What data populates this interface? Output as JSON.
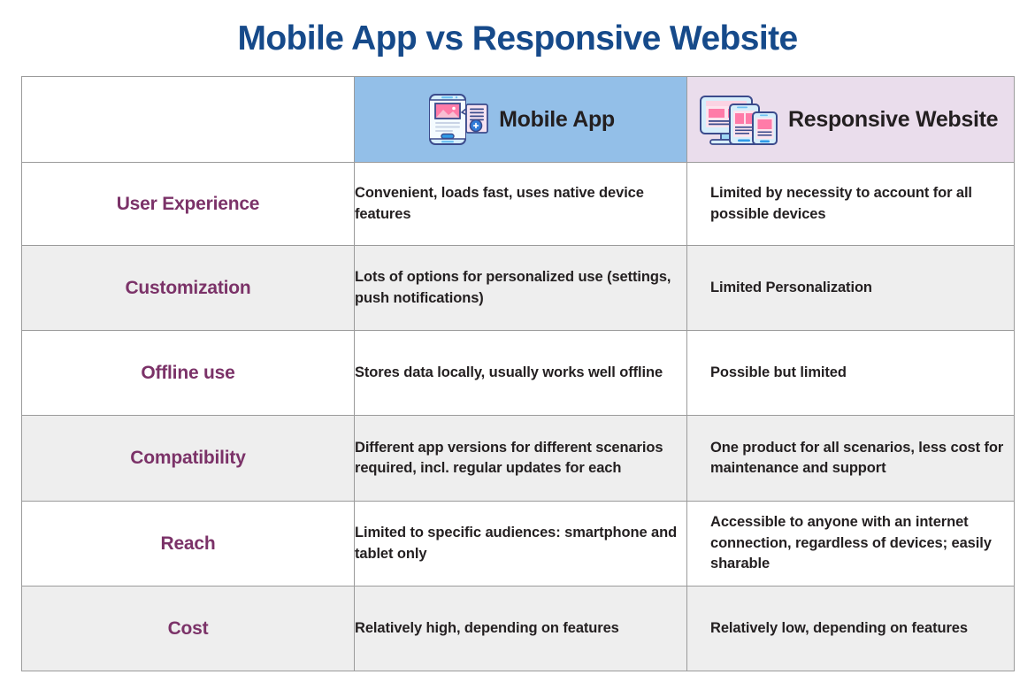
{
  "title": "Mobile App vs Responsive Website",
  "colors": {
    "title_blue": "#164A8A",
    "label_purple": "#7B3268",
    "header_app_bg": "#93BFE8",
    "header_web_bg": "#EADDEC",
    "row_shade_bg": "#EEEEEE",
    "border": "#9b9b9b",
    "body_text": "#231f20"
  },
  "table": {
    "columns": [
      {
        "key": "criteria",
        "label": ""
      },
      {
        "key": "mobile_app",
        "label": "Mobile App",
        "icon": "mobile-app-icon"
      },
      {
        "key": "responsive_website",
        "label": "Responsive Website",
        "icon": "responsive-devices-icon"
      }
    ],
    "rows": [
      {
        "label": "User Experience",
        "mobile_app": "Convenient, loads fast, uses native device features",
        "responsive_website": "Limited by necessity to account for all possible devices",
        "shaded": false
      },
      {
        "label": "Customization",
        "mobile_app": "Lots of options for personalized use (settings, push notifications)",
        "responsive_website": "Limited Personalization",
        "shaded": true
      },
      {
        "label": "Offline use",
        "mobile_app": "Stores data locally, usually works well offline",
        "responsive_website": "Possible but limited",
        "shaded": false
      },
      {
        "label": "Compatibility",
        "mobile_app": "Different app versions for different scenarios required, incl. regular updates for each",
        "responsive_website": "One product for all scenarios, less cost for maintenance and support",
        "shaded": true
      },
      {
        "label": "Reach",
        "mobile_app": "Limited to specific audiences: smartphone and tablet only",
        "responsive_website": "Accessible to anyone with an internet connection, regardless of devices; easily sharable",
        "shaded": false
      },
      {
        "label": "Cost",
        "mobile_app": "Relatively high, depending on features",
        "responsive_website": "Relatively low, depending on features",
        "shaded": true
      }
    ]
  }
}
